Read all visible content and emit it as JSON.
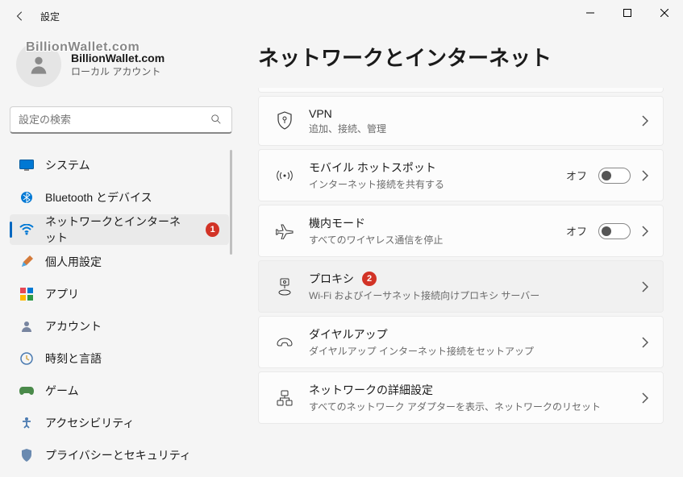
{
  "window": {
    "title": "設定"
  },
  "profile": {
    "name": "BillionWallet.com",
    "sub": "ローカル アカウント",
    "watermark": "BillionWallet.com"
  },
  "search": {
    "placeholder": "設定の検索"
  },
  "nav": {
    "items": [
      {
        "label": "システム"
      },
      {
        "label": "Bluetooth とデバイス"
      },
      {
        "label": "ネットワークとインターネット",
        "badge": "1"
      },
      {
        "label": "個人用設定"
      },
      {
        "label": "アプリ"
      },
      {
        "label": "アカウント"
      },
      {
        "label": "時刻と言語"
      },
      {
        "label": "ゲーム"
      },
      {
        "label": "アクセシビリティ"
      },
      {
        "label": "プライバシーとセキュリティ"
      }
    ]
  },
  "page": {
    "title": "ネットワークとインターネット"
  },
  "cards": {
    "vpn": {
      "title": "VPN",
      "sub": "追加、接続、管理"
    },
    "hotspot": {
      "title": "モバイル ホットスポット",
      "sub": "インターネット接続を共有する",
      "toggleLabel": "オフ"
    },
    "airplane": {
      "title": "機内モード",
      "sub": "すべてのワイヤレス通信を停止",
      "toggleLabel": "オフ"
    },
    "proxy": {
      "title": "プロキシ",
      "sub": "Wi-Fi およびイーサネット接続向けプロキシ サーバー",
      "badge": "2"
    },
    "dialup": {
      "title": "ダイヤルアップ",
      "sub": "ダイヤルアップ インターネット接続をセットアップ"
    },
    "advanced": {
      "title": "ネットワークの詳細設定",
      "sub": "すべてのネットワーク アダプターを表示、ネットワークのリセット"
    }
  }
}
